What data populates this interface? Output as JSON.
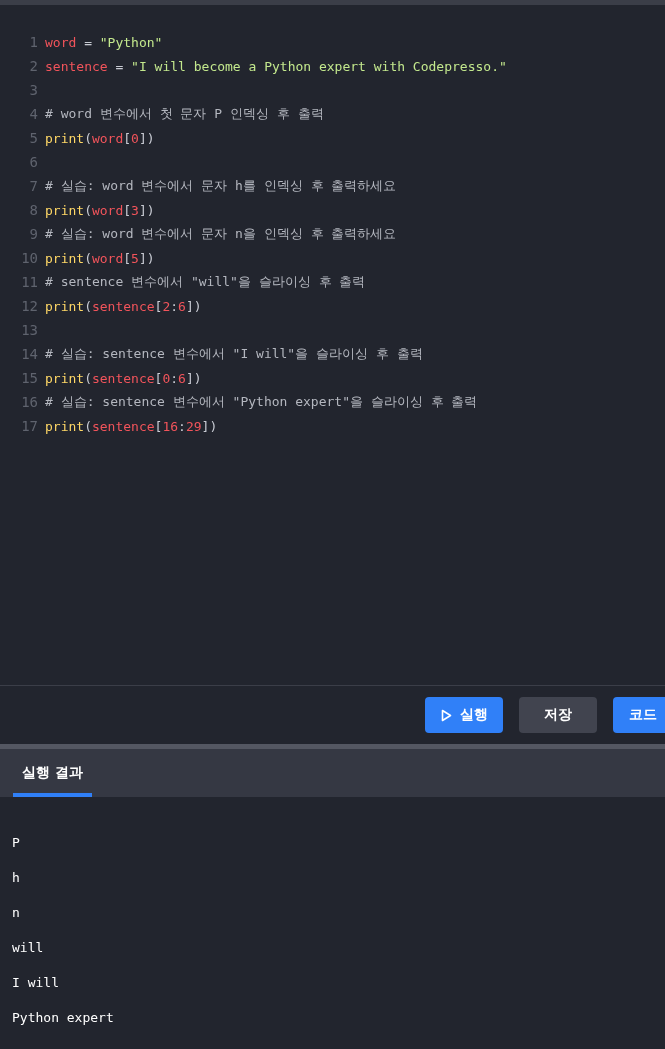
{
  "editor": {
    "lines": [
      {
        "number": "1",
        "tokens": [
          {
            "t": "word",
            "kind": "var"
          },
          {
            "t": " = ",
            "kind": "op"
          },
          {
            "t": "\"Python\"",
            "kind": "str"
          }
        ]
      },
      {
        "number": "2",
        "tokens": [
          {
            "t": "sentence",
            "kind": "var"
          },
          {
            "t": " = ",
            "kind": "op"
          },
          {
            "t": "\"I will become a Python expert with Codepresso.\"",
            "kind": "str"
          }
        ]
      },
      {
        "number": "3"
      },
      {
        "number": "4",
        "tokens": [
          {
            "t": "# word 변수에서 첫 문자 P 인덱싱 후 출력",
            "kind": "comment"
          }
        ]
      },
      {
        "number": "5",
        "tokens": [
          {
            "t": "print",
            "kind": "fn"
          },
          {
            "t": "(",
            "kind": "op"
          },
          {
            "t": "word",
            "kind": "var"
          },
          {
            "t": "[",
            "kind": "op"
          },
          {
            "t": "0",
            "kind": "num"
          },
          {
            "t": "])",
            "kind": "op"
          }
        ]
      },
      {
        "number": "6"
      },
      {
        "number": "7",
        "tokens": [
          {
            "t": "# 실습: word 변수에서 문자 h를 인덱싱 후 출력하세요",
            "kind": "comment"
          }
        ]
      },
      {
        "number": "8",
        "tokens": [
          {
            "t": "print",
            "kind": "fn"
          },
          {
            "t": "(",
            "kind": "op"
          },
          {
            "t": "word",
            "kind": "var"
          },
          {
            "t": "[",
            "kind": "op"
          },
          {
            "t": "3",
            "kind": "num"
          },
          {
            "t": "])",
            "kind": "op"
          }
        ]
      },
      {
        "number": "9",
        "tokens": [
          {
            "t": "# 실습: word 변수에서 문자 n을 인덱싱 후 출력하세요",
            "kind": "comment"
          }
        ]
      },
      {
        "number": "10",
        "tokens": [
          {
            "t": "print",
            "kind": "fn"
          },
          {
            "t": "(",
            "kind": "op"
          },
          {
            "t": "word",
            "kind": "var"
          },
          {
            "t": "[",
            "kind": "op"
          },
          {
            "t": "5",
            "kind": "num"
          },
          {
            "t": "])",
            "kind": "op"
          }
        ]
      },
      {
        "number": "11",
        "tokens": [
          {
            "t": "# sentence 변수에서 \"will\"을 슬라이싱 후 출력",
            "kind": "comment"
          }
        ]
      },
      {
        "number": "12",
        "tokens": [
          {
            "t": "print",
            "kind": "fn"
          },
          {
            "t": "(",
            "kind": "op"
          },
          {
            "t": "sentence",
            "kind": "var"
          },
          {
            "t": "[",
            "kind": "op"
          },
          {
            "t": "2",
            "kind": "num"
          },
          {
            "t": ":",
            "kind": "op"
          },
          {
            "t": "6",
            "kind": "num"
          },
          {
            "t": "])",
            "kind": "op"
          }
        ]
      },
      {
        "number": "13"
      },
      {
        "number": "14",
        "tokens": [
          {
            "t": "# 실습: sentence 변수에서 \"I will\"을 슬라이싱 후 출력",
            "kind": "comment"
          }
        ]
      },
      {
        "number": "15",
        "tokens": [
          {
            "t": "print",
            "kind": "fn"
          },
          {
            "t": "(",
            "kind": "op"
          },
          {
            "t": "sentence",
            "kind": "var"
          },
          {
            "t": "[",
            "kind": "op"
          },
          {
            "t": "0",
            "kind": "num"
          },
          {
            "t": ":",
            "kind": "op"
          },
          {
            "t": "6",
            "kind": "num"
          },
          {
            "t": "])",
            "kind": "op"
          }
        ]
      },
      {
        "number": "16",
        "tokens": [
          {
            "t": "# 실습: sentence 변수에서 \"Python expert\"을 슬라이싱 후 출력",
            "kind": "comment"
          }
        ]
      },
      {
        "number": "17",
        "tokens": [
          {
            "t": "print",
            "kind": "fn"
          },
          {
            "t": "(",
            "kind": "op"
          },
          {
            "t": "sentence",
            "kind": "var"
          },
          {
            "t": "[",
            "kind": "op"
          },
          {
            "t": "16",
            "kind": "num"
          },
          {
            "t": ":",
            "kind": "op"
          },
          {
            "t": "29",
            "kind": "num"
          },
          {
            "t": "])",
            "kind": "op"
          }
        ]
      }
    ]
  },
  "buttons": [
    {
      "label": "실행",
      "kind": "run"
    },
    {
      "label": "저장",
      "kind": "save"
    },
    {
      "label": "코드",
      "kind": "primary"
    }
  ],
  "result_tabs": [
    {
      "label": "실행 결과",
      "selected": true
    }
  ],
  "output": [
    "P",
    "h",
    "n",
    "will",
    "I will",
    "Python expert"
  ]
}
